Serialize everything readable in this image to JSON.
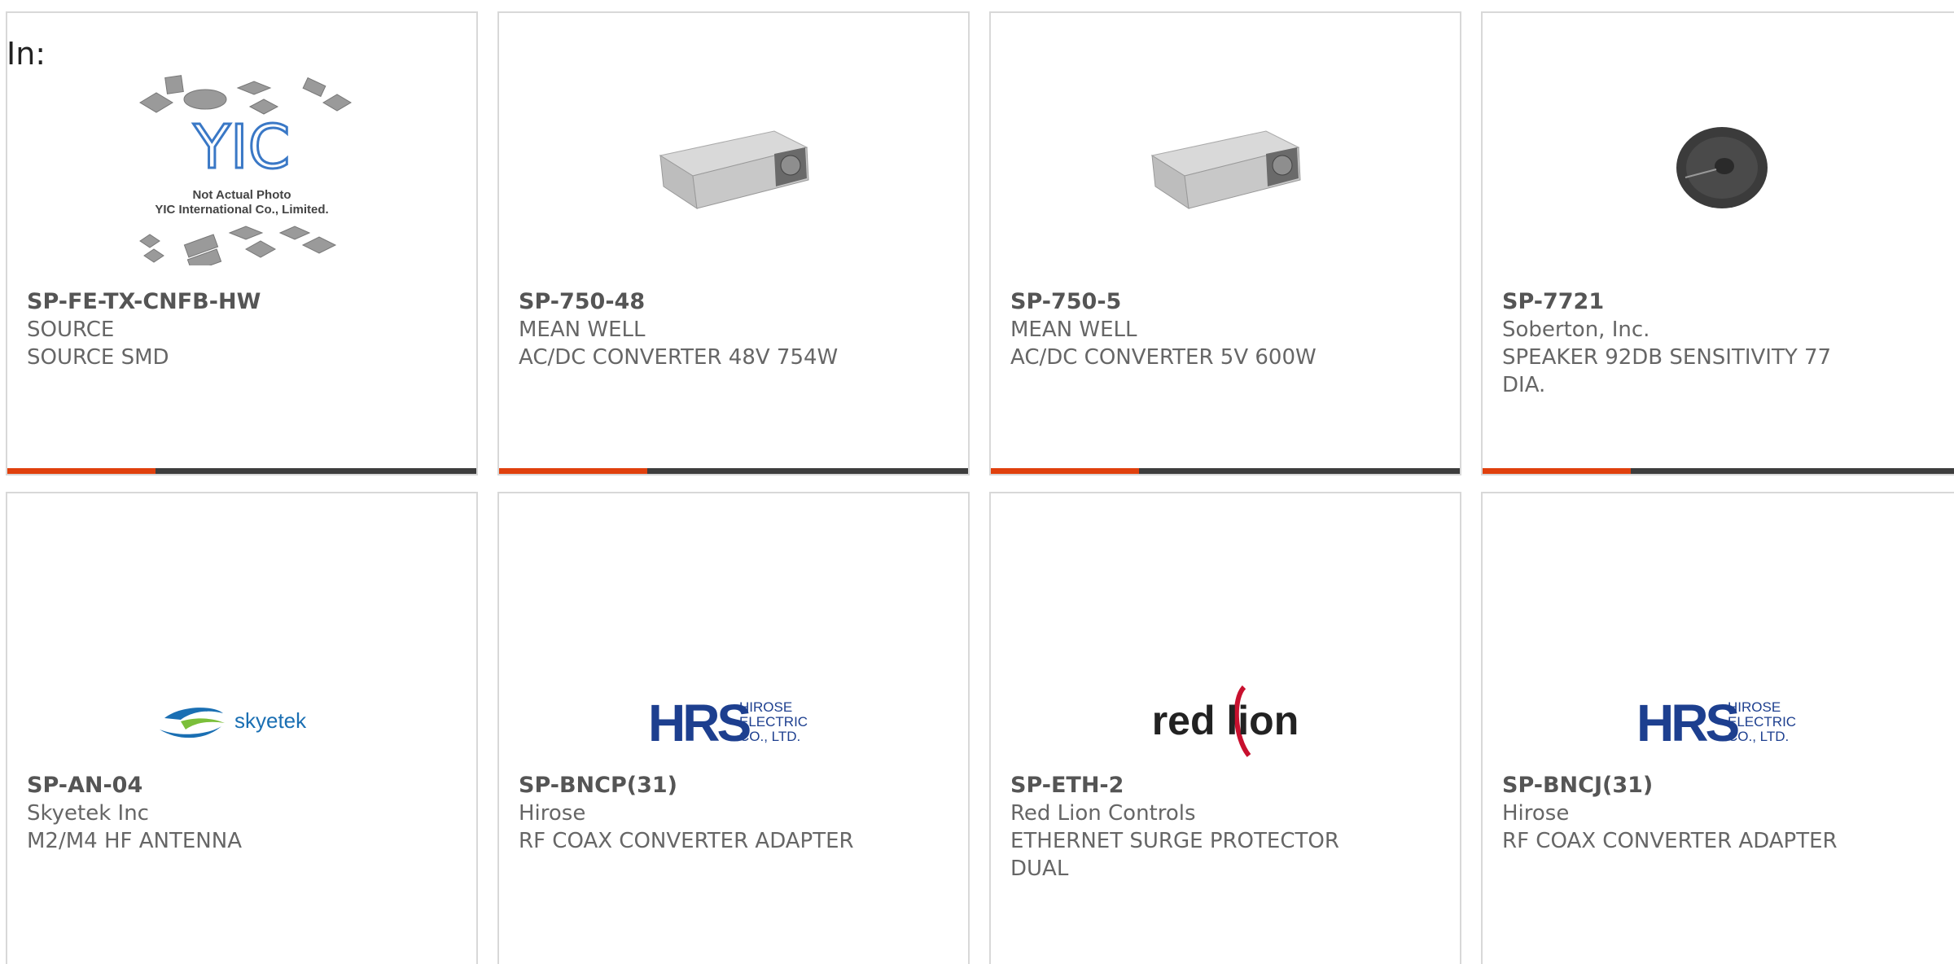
{
  "filter_label": "In:",
  "products": [
    {
      "part": "SP-FE-TX-CNFB-HW",
      "manufacturer": "SOURCE",
      "description": "SOURCE SMD",
      "image": "yic-not-actual-photo",
      "image_caption_1": "Not Actual Photo",
      "image_caption_2": "YIC International Co., Limited.",
      "image_logo": "YIC"
    },
    {
      "part": "SP-750-48",
      "manufacturer": "MEAN WELL",
      "description": "AC/DC CONVERTER 48V 754W",
      "image": "power-supply-photo"
    },
    {
      "part": "SP-750-5",
      "manufacturer": "MEAN WELL",
      "description": "AC/DC CONVERTER 5V 600W",
      "image": "power-supply-photo"
    },
    {
      "part": "SP-7721",
      "manufacturer": "Soberton, Inc.",
      "description": "SPEAKER 92DB SENSITIVITY 77 DIA.",
      "image": "speaker-photo"
    },
    {
      "part": "SP-AN-04",
      "manufacturer": "Skyetek Inc",
      "description": "M2/M4 HF ANTENNA",
      "image": "skyetek-logo",
      "logo_text": "skyetek"
    },
    {
      "part": "SP-BNCP(31)",
      "manufacturer": "Hirose",
      "description": "RF COAX CONVERTER ADAPTER",
      "image": "hirose-logo",
      "logo_mark": "HRS",
      "logo_l1": "HIROSE",
      "logo_l2": "ELECTRIC",
      "logo_l3": "CO., LTD."
    },
    {
      "part": "SP-ETH-2",
      "manufacturer": "Red Lion Controls",
      "description": "ETHERNET SURGE PROTECTOR DUAL",
      "image": "red-lion-logo",
      "logo_text": "red lion"
    },
    {
      "part": "SP-BNCJ(31)",
      "manufacturer": "Hirose",
      "description": "RF COAX CONVERTER ADAPTER",
      "image": "hirose-logo",
      "logo_mark": "HRS",
      "logo_l1": "HIROSE",
      "logo_l2": "ELECTRIC",
      "logo_l3": "CO., LTD."
    }
  ],
  "colors": {
    "accent": "#e0400d",
    "bar": "#3d3d3d",
    "hirose_blue": "#1d3f8f",
    "skyetek_green": "#7bbf3a",
    "skyetek_blue": "#1a6fb3",
    "redlion_red": "#c8102e"
  }
}
